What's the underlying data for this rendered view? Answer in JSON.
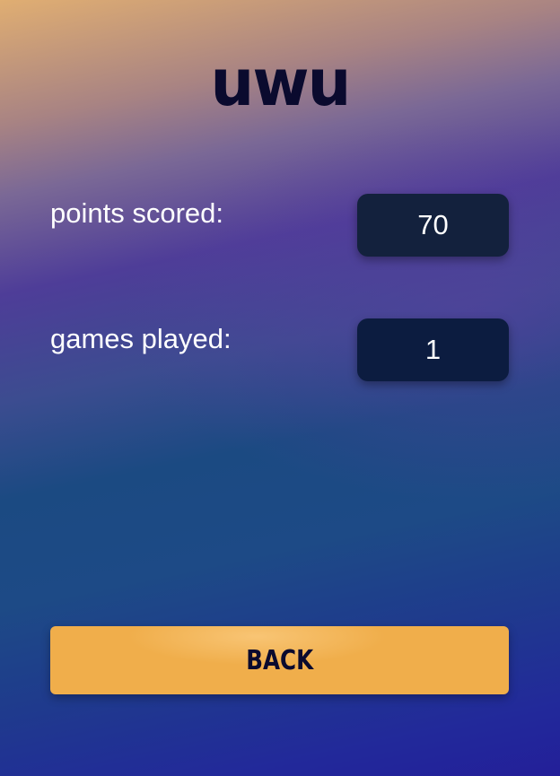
{
  "header": {
    "title": "uwu"
  },
  "stats": {
    "points_label": "points scored:",
    "points_value": "70",
    "games_label": "games played:",
    "games_value": "1"
  },
  "actions": {
    "back_label": "BACK"
  },
  "colors": {
    "button_accent": "#f0ae4b",
    "value_box": "#13213d",
    "title_text": "#0a0a2e"
  }
}
